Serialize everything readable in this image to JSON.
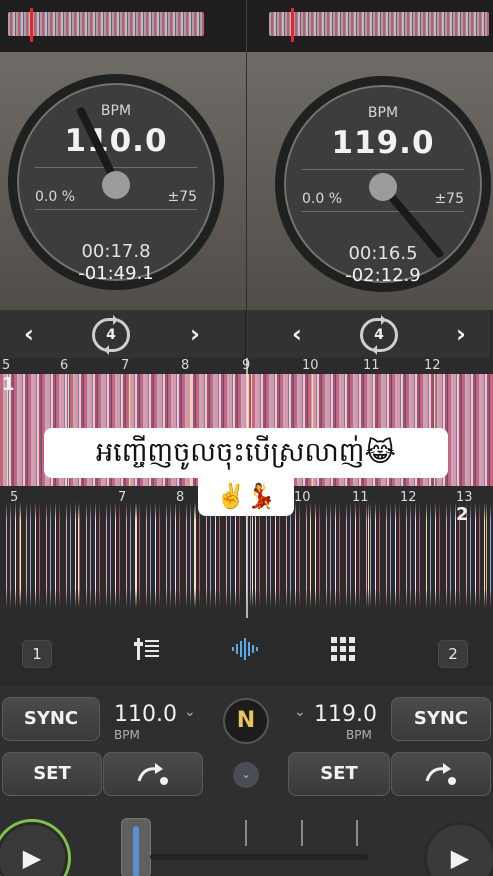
{
  "deck_left": {
    "bpm_label": "BPM",
    "bpm": "110.0",
    "pitch": "0.0 %",
    "range": "±75",
    "elapsed": "00:17.8",
    "remaining": "-01:49.1"
  },
  "deck_right": {
    "bpm_label": "BPM",
    "bpm": "119.0",
    "pitch": "0.0 %",
    "range": "±75",
    "elapsed": "00:16.5",
    "remaining": "-02:12.9"
  },
  "nav": {
    "prev": "‹",
    "next": "›",
    "loop_left": "4",
    "loop_right": "4"
  },
  "ruler_top": [
    "5",
    "6",
    "7",
    "8",
    "9",
    "10",
    "11",
    "12"
  ],
  "ruler_bottom": [
    "5",
    "7",
    "8",
    "10",
    "11",
    "12",
    "13"
  ],
  "lane_tags": {
    "top": "1",
    "bottom": "2"
  },
  "caption": {
    "line1": "អញ្ចើញចូលចុះបើស្រលាញ់😹",
    "line2": "✌️💃"
  },
  "toolbar": {
    "deck_left_num": "1",
    "deck_right_num": "2",
    "mixer_icon": "mixer-icon",
    "wave_icon": "waveform-icon",
    "grid_icon": "pads-grid-icon"
  },
  "controls": {
    "sync_label": "SYNC",
    "set_label": "SET",
    "bpm_left": "110.0",
    "bpm_right": "119.0",
    "bpm_unit": "BPM",
    "logo_letter": "N",
    "play_glyph": "▶"
  },
  "colors": {
    "accent_play": "#7ec14b",
    "fader_blue": "#5a8fd2",
    "playhead_red": "#e3262a"
  }
}
